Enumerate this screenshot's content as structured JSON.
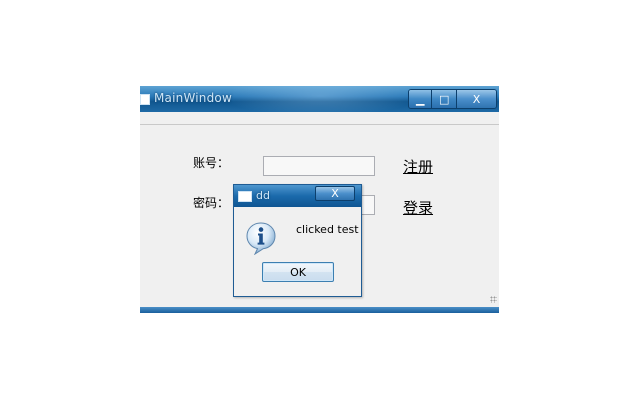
{
  "main_window": {
    "title": "MainWindow",
    "controls": {
      "minimize": "▁",
      "maximize": "□",
      "close": "X"
    },
    "form": {
      "account_label": "账号：",
      "password_label": "密码：",
      "account_value": "",
      "password_value": "",
      "register_link": "注册",
      "login_link": "登录"
    }
  },
  "dialog": {
    "title": "dd",
    "close": "X",
    "icon": "info-icon",
    "message": "clicked test",
    "ok_label": "OK"
  },
  "colors": {
    "titlebar": "#1b6aab",
    "window_bg": "#f0f0f0",
    "status_bar": "#1a5f9c"
  }
}
